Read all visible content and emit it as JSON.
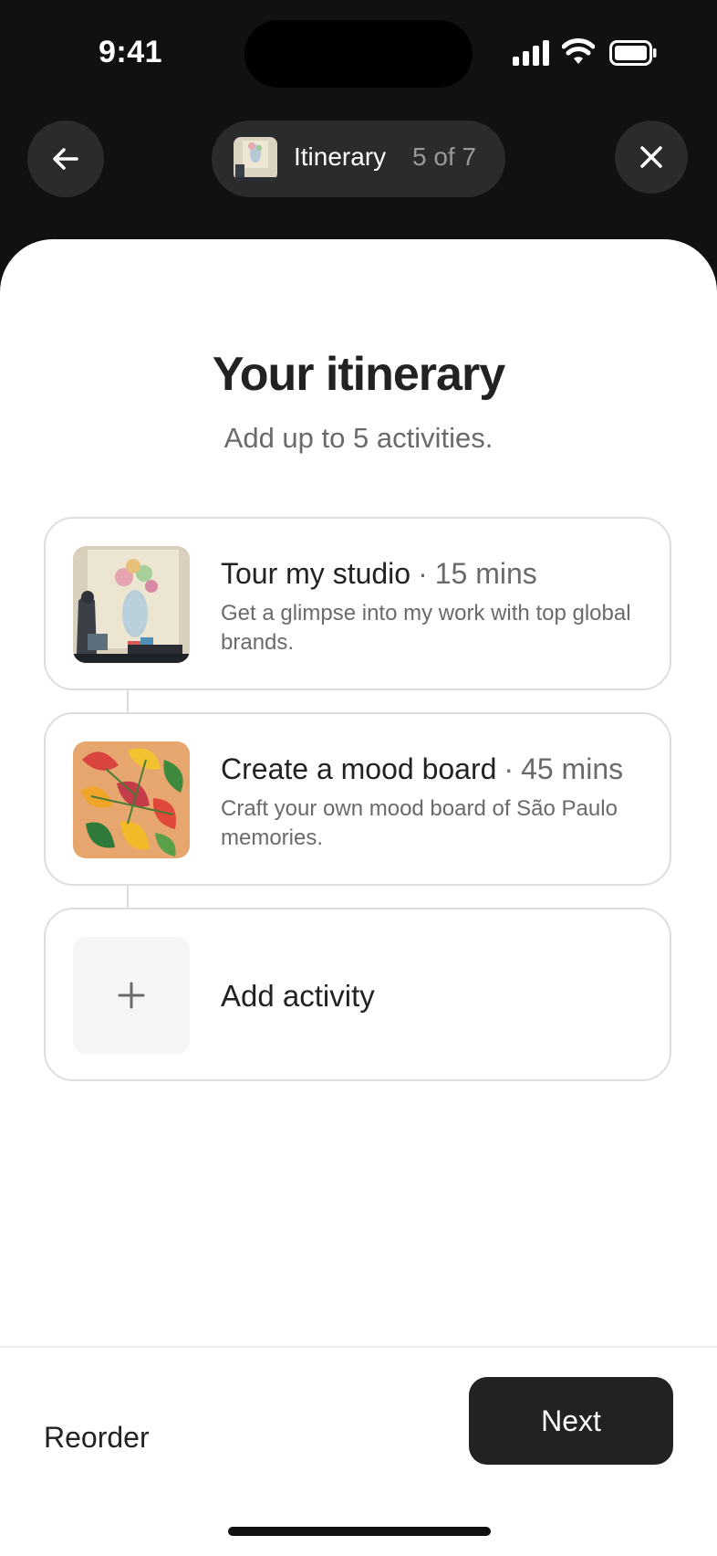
{
  "status_bar": {
    "time": "9:41"
  },
  "header": {
    "pill_title": "Itinerary",
    "pill_step": "5 of 7"
  },
  "page": {
    "title": "Your itinerary",
    "subtitle": "Add up to 5 activities."
  },
  "activities": [
    {
      "title": "Tour my studio",
      "separator": "·",
      "duration": "15 mins",
      "description": "Get a glimpse into my work with top global brands."
    },
    {
      "title": "Create a mood board",
      "separator": "·",
      "duration": "45 mins",
      "description": "Craft your own mood board of São Paulo memories."
    }
  ],
  "add_activity": {
    "label": "Add activity",
    "icon": "plus-icon"
  },
  "footer": {
    "reorder_label": "Reorder",
    "next_label": "Next"
  },
  "colors": {
    "dark": "#222222",
    "muted": "#6a6a6a",
    "border": "#dddddd",
    "background_top": "#111111"
  }
}
